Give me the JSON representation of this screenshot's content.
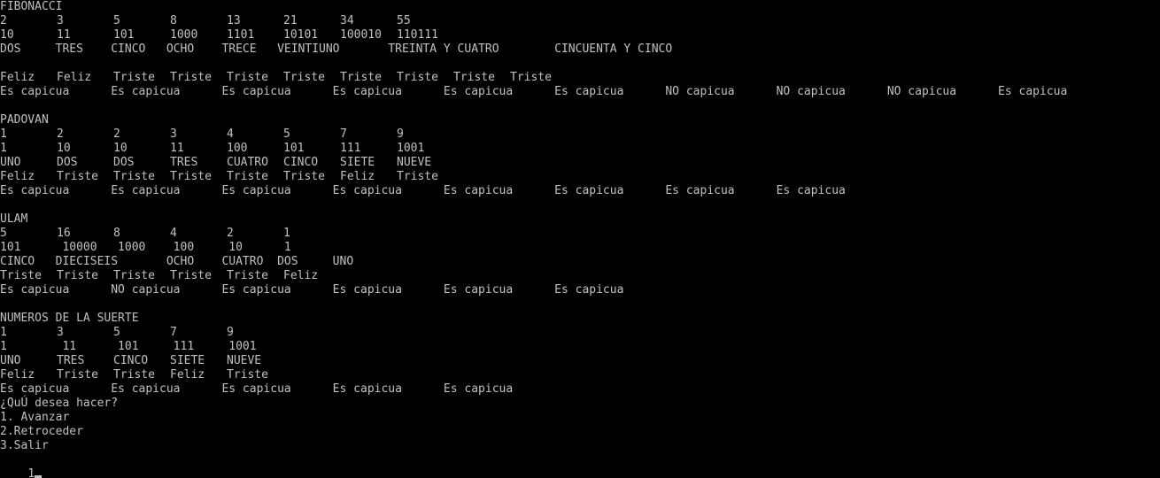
{
  "terminal": {
    "lines": [
      {
        "text": "FIBONACCI"
      },
      {
        "cells": [
          "2",
          "3",
          "5",
          "8",
          "13",
          "21",
          "34",
          "55"
        ]
      },
      {
        "cells": [
          "10",
          "11",
          "101",
          "1000",
          "1101",
          "10101",
          "100010",
          "110111"
        ]
      },
      {
        "text": "DOS     TRES    CINCO   OCHO    TRECE   VEINTIUNO       TREINTA Y CUATRO        CINCUENTA Y CINCO"
      },
      {
        "text": ""
      },
      {
        "cells": [
          "Feliz",
          "Feliz",
          "Triste",
          "Triste",
          "Triste",
          "Triste",
          "Triste",
          "Triste",
          "Triste",
          "Triste"
        ]
      },
      {
        "text": "Es capicua      Es capicua      Es capicua      Es capicua      Es capicua      Es capicua      NO capicua      NO capicua      NO capicua      Es capicua"
      },
      {
        "text": ""
      },
      {
        "text": "PADOVAN"
      },
      {
        "cells": [
          "1",
          "2",
          "2",
          "3",
          "4",
          "5",
          "7",
          "9"
        ]
      },
      {
        "cells": [
          "1",
          "10",
          "10",
          "11",
          "100",
          "101",
          "111",
          "1001"
        ]
      },
      {
        "cells": [
          "UNO",
          "DOS",
          "DOS",
          "TRES",
          "CUATRO",
          "CINCO",
          "SIETE",
          "NUEVE"
        ]
      },
      {
        "cells": [
          "Feliz",
          "Triste",
          "Triste",
          "Triste",
          "Triste",
          "Triste",
          "Feliz",
          "Triste"
        ]
      },
      {
        "text": "Es capicua      Es capicua      Es capicua      Es capicua      Es capicua      Es capicua      Es capicua      Es capicua"
      },
      {
        "text": ""
      },
      {
        "text": "ULAM"
      },
      {
        "cells": [
          "5",
          "16",
          "8",
          "4",
          "2",
          "1"
        ]
      },
      {
        "text": "101      10000   1000    100     10      1"
      },
      {
        "text": "CINCO   DIECISEIS       OCHO    CUATRO  DOS     UNO"
      },
      {
        "cells": [
          "Triste",
          "Triste",
          "Triste",
          "Triste",
          "Triste",
          "Feliz"
        ]
      },
      {
        "text": "Es capicua      NO capicua      Es capicua      Es capicua      Es capicua      Es capicua"
      },
      {
        "text": ""
      },
      {
        "text": "NUMEROS DE LA SUERTE"
      },
      {
        "cells": [
          "1",
          "3",
          "5",
          "7",
          "9"
        ]
      },
      {
        "text": "1        11      101     111     1001"
      },
      {
        "cells": [
          "UNO",
          "TRES",
          "CINCO",
          "SIETE",
          "NUEVE"
        ]
      },
      {
        "cells": [
          "Feliz",
          "Triste",
          "Triste",
          "Feliz",
          "Triste"
        ]
      },
      {
        "text": "Es capicua      Es capicua      Es capicua      Es capicua      Es capicua"
      },
      {
        "text": "¿QuÚ desea hacer?"
      },
      {
        "text": "1. Avanzar"
      },
      {
        "text": "2.Retroceder"
      },
      {
        "text": "3.Salir"
      }
    ],
    "input_value": "1",
    "colors": {
      "background": "#000000",
      "foreground": "#c0c0c0"
    }
  }
}
